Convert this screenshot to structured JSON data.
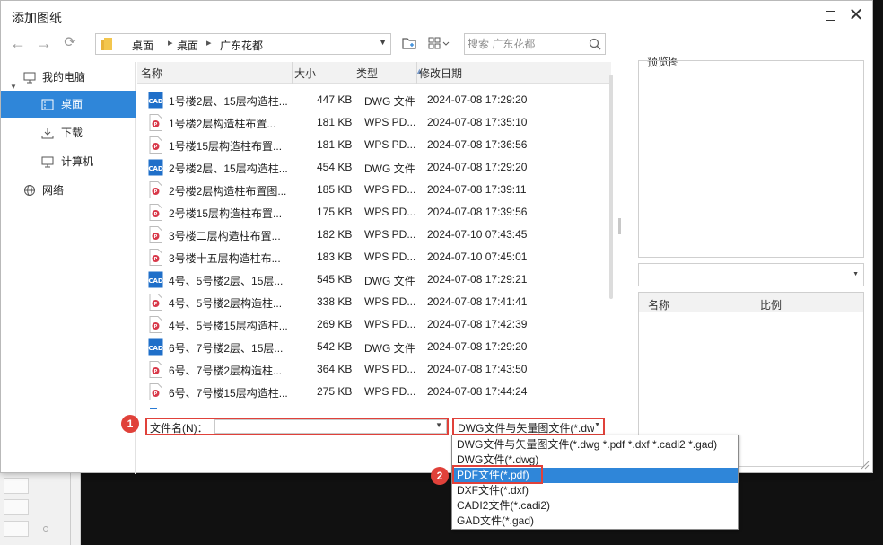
{
  "window": {
    "title": "添加图纸"
  },
  "nav": {
    "breadcrumbs": [
      "桌面",
      "桌面",
      "广东花都"
    ],
    "search_placeholder": "搜索 广东花都"
  },
  "sidebar": {
    "items": [
      {
        "label": "我的电脑",
        "icon": "computer-icon"
      },
      {
        "label": "桌面",
        "icon": "desktop-icon",
        "selected": true
      },
      {
        "label": "下载",
        "icon": "download-icon"
      },
      {
        "label": "计算机",
        "icon": "monitor-icon"
      },
      {
        "label": "网络",
        "icon": "network-icon"
      }
    ]
  },
  "columns": {
    "name": "名称",
    "size": "大小",
    "type": "类型",
    "date": "修改日期"
  },
  "files": [
    {
      "name": "1号楼2层、15层构造柱...",
      "size": "447 KB",
      "type": "DWG 文件",
      "date": "2024-07-08 17:29:20",
      "kind": "cad"
    },
    {
      "name": "1号楼2层构造柱布置...",
      "size": "181 KB",
      "type": "WPS PD...",
      "date": "2024-07-08 17:35:10",
      "kind": "pdf"
    },
    {
      "name": "1号楼15层构造柱布置...",
      "size": "181 KB",
      "type": "WPS PD...",
      "date": "2024-07-08 17:36:56",
      "kind": "pdf"
    },
    {
      "name": "2号楼2层、15层构造柱...",
      "size": "454 KB",
      "type": "DWG 文件",
      "date": "2024-07-08 17:29:20",
      "kind": "cad"
    },
    {
      "name": "2号楼2层构造柱布置图...",
      "size": "185 KB",
      "type": "WPS PD...",
      "date": "2024-07-08 17:39:11",
      "kind": "pdf"
    },
    {
      "name": "2号楼15层构造柱布置...",
      "size": "175 KB",
      "type": "WPS PD...",
      "date": "2024-07-08 17:39:56",
      "kind": "pdf"
    },
    {
      "name": "3号楼二层构造柱布置...",
      "size": "182 KB",
      "type": "WPS PD...",
      "date": "2024-07-10 07:43:45",
      "kind": "pdf"
    },
    {
      "name": "3号楼十五层构造柱布...",
      "size": "183 KB",
      "type": "WPS PD...",
      "date": "2024-07-10 07:45:01",
      "kind": "pdf"
    },
    {
      "name": "4号、5号楼2层、15层...",
      "size": "545 KB",
      "type": "DWG 文件",
      "date": "2024-07-08 17:29:21",
      "kind": "cad"
    },
    {
      "name": "4号、5号楼2层构造柱...",
      "size": "338 KB",
      "type": "WPS PD...",
      "date": "2024-07-08 17:41:41",
      "kind": "pdf"
    },
    {
      "name": "4号、5号楼15层构造柱...",
      "size": "269 KB",
      "type": "WPS PD...",
      "date": "2024-07-08 17:42:39",
      "kind": "pdf"
    },
    {
      "name": "6号、7号楼2层、15层...",
      "size": "542 KB",
      "type": "DWG 文件",
      "date": "2024-07-08 17:29:20",
      "kind": "cad"
    },
    {
      "name": "6号、7号楼2层构造柱...",
      "size": "364 KB",
      "type": "WPS PD...",
      "date": "2024-07-08 17:43:50",
      "kind": "pdf"
    },
    {
      "name": "6号、7号楼15层构造柱...",
      "size": "275 KB",
      "type": "WPS PD...",
      "date": "2024-07-08 17:44:24",
      "kind": "pdf"
    }
  ],
  "filename": {
    "label": "文件名(N)：",
    "value": ""
  },
  "filetype": {
    "selected": "DWG文件与矢量图文件(*.dw",
    "options": [
      "DWG文件与矢量图文件(*.dwg *.pdf *.dxf *.cadi2 *.gad)",
      "DWG文件(*.dwg)",
      "PDF文件(*.pdf)",
      "DXF文件(*.dxf)",
      "CADI2文件(*.cadi2)",
      "GAD文件(*.gad)"
    ],
    "highlighted_index": 2
  },
  "markers": [
    "1",
    "2"
  ],
  "preview": {
    "label": "预览图"
  },
  "layout_table": {
    "col_name": "名称",
    "col_scale": "比例"
  },
  "colors": {
    "accent": "#2f86d9",
    "marker": "#e0413a",
    "cad_icon": "#1f6fc9",
    "pdf_icon": "#d8394a"
  }
}
